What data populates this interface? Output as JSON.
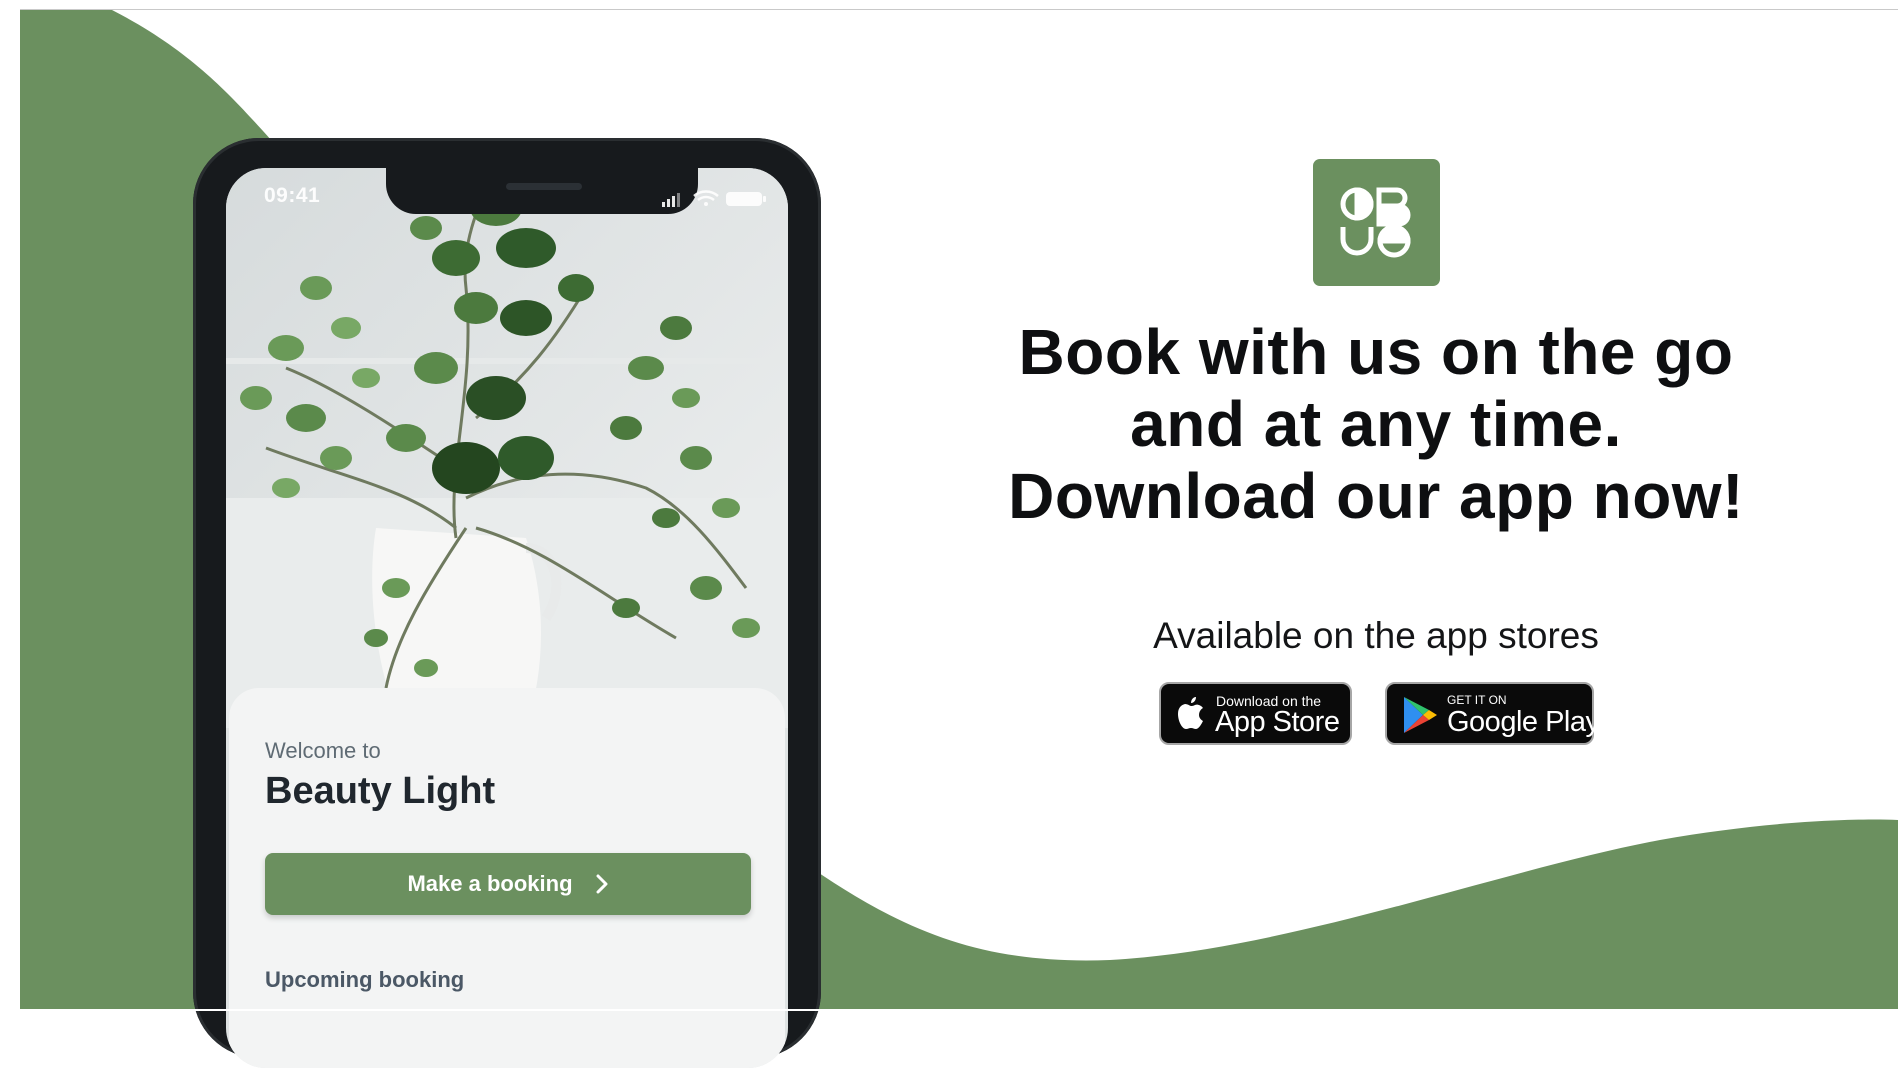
{
  "colors": {
    "brand_green": "#6b905f",
    "phone_frame": "#171a1d",
    "headline_text": "#0e0f11",
    "card_background": "#f3f4f4"
  },
  "phone": {
    "status_time": "09:41",
    "status_icons": [
      "signal-icon",
      "wifi-icon",
      "battery-icon"
    ],
    "welcome_label": "Welcome to",
    "brand_name": "Beauty Light",
    "booking_button_label": "Make a booking",
    "booking_button_icon": "chevron-right-icon",
    "upcoming_label": "Upcoming booking"
  },
  "promo": {
    "logo_icon": "brand-logo-icon",
    "headline_lines": [
      "Book with us on the go",
      "and at any time.",
      "Download our app now!"
    ],
    "available_label": "Available on the app stores"
  },
  "badges": {
    "apple": {
      "small": "Download on the",
      "big": "App Store",
      "icon": "apple-icon"
    },
    "google": {
      "small": "GET IT ON",
      "big": "Google Play",
      "icon": "google-play-icon"
    }
  }
}
